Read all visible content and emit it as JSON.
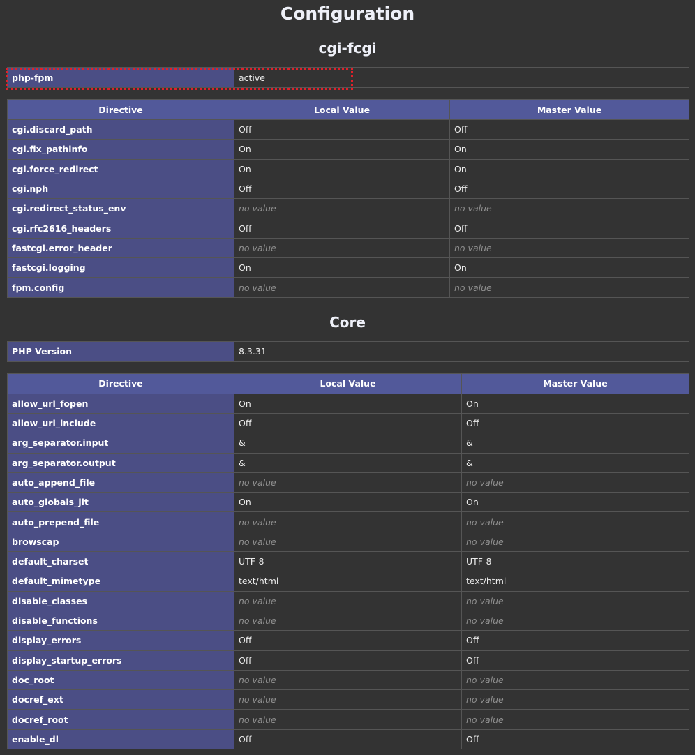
{
  "page_title": "Configuration",
  "cgi": {
    "title": "cgi-fcgi",
    "info_rows": [
      {
        "name": "php-fpm",
        "value": "active"
      }
    ],
    "headers": {
      "directive": "Directive",
      "local": "Local Value",
      "master": "Master Value"
    },
    "rows": [
      {
        "name": "cgi.discard_path",
        "local": "Off",
        "master": "Off"
      },
      {
        "name": "cgi.fix_pathinfo",
        "local": "On",
        "master": "On"
      },
      {
        "name": "cgi.force_redirect",
        "local": "On",
        "master": "On"
      },
      {
        "name": "cgi.nph",
        "local": "Off",
        "master": "Off"
      },
      {
        "name": "cgi.redirect_status_env",
        "local": "no value",
        "master": "no value",
        "nv": true
      },
      {
        "name": "cgi.rfc2616_headers",
        "local": "Off",
        "master": "Off"
      },
      {
        "name": "fastcgi.error_header",
        "local": "no value",
        "master": "no value",
        "nv": true
      },
      {
        "name": "fastcgi.logging",
        "local": "On",
        "master": "On"
      },
      {
        "name": "fpm.config",
        "local": "no value",
        "master": "no value",
        "nv": true
      }
    ]
  },
  "core": {
    "title": "Core",
    "info_rows": [
      {
        "name": "PHP Version",
        "value": "8.3.31"
      }
    ],
    "headers": {
      "directive": "Directive",
      "local": "Local Value",
      "master": "Master Value"
    },
    "rows": [
      {
        "name": "allow_url_fopen",
        "local": "On",
        "master": "On"
      },
      {
        "name": "allow_url_include",
        "local": "Off",
        "master": "Off"
      },
      {
        "name": "arg_separator.input",
        "local": "&",
        "master": "&"
      },
      {
        "name": "arg_separator.output",
        "local": "&",
        "master": "&"
      },
      {
        "name": "auto_append_file",
        "local": "no value",
        "master": "no value",
        "nv": true
      },
      {
        "name": "auto_globals_jit",
        "local": "On",
        "master": "On"
      },
      {
        "name": "auto_prepend_file",
        "local": "no value",
        "master": "no value",
        "nv": true
      },
      {
        "name": "browscap",
        "local": "no value",
        "master": "no value",
        "nv": true
      },
      {
        "name": "default_charset",
        "local": "UTF-8",
        "master": "UTF-8"
      },
      {
        "name": "default_mimetype",
        "local": "text/html",
        "master": "text/html"
      },
      {
        "name": "disable_classes",
        "local": "no value",
        "master": "no value",
        "nv": true
      },
      {
        "name": "disable_functions",
        "local": "no value",
        "master": "no value",
        "nv": true
      },
      {
        "name": "display_errors",
        "local": "Off",
        "master": "Off"
      },
      {
        "name": "display_startup_errors",
        "local": "Off",
        "master": "Off"
      },
      {
        "name": "doc_root",
        "local": "no value",
        "master": "no value",
        "nv": true
      },
      {
        "name": "docref_ext",
        "local": "no value",
        "master": "no value",
        "nv": true
      },
      {
        "name": "docref_root",
        "local": "no value",
        "master": "no value",
        "nv": true
      },
      {
        "name": "enable_dl",
        "local": "Off",
        "master": "Off"
      }
    ]
  },
  "colors": {
    "background": "#333333",
    "header_bg": "#52599a",
    "label_bg": "#4b4e85",
    "highlight": "#e0202a"
  }
}
